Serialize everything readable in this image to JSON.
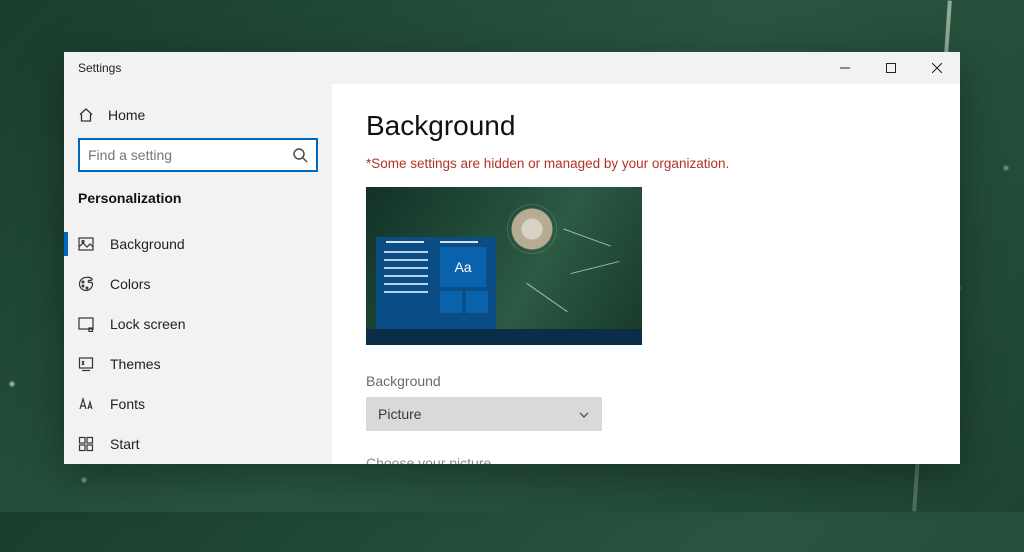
{
  "window": {
    "title": "Settings"
  },
  "sidebar": {
    "home": "Home",
    "search_placeholder": "Find a setting",
    "category": "Personalization",
    "items": [
      {
        "label": "Background",
        "active": true
      },
      {
        "label": "Colors"
      },
      {
        "label": "Lock screen"
      },
      {
        "label": "Themes"
      },
      {
        "label": "Fonts"
      },
      {
        "label": "Start"
      }
    ]
  },
  "page": {
    "title": "Background",
    "warning": "*Some settings are hidden or managed by your organization.",
    "preview_sample_text": "Aa",
    "background_label": "Background",
    "background_value": "Picture",
    "choose_label": "Choose your picture"
  }
}
